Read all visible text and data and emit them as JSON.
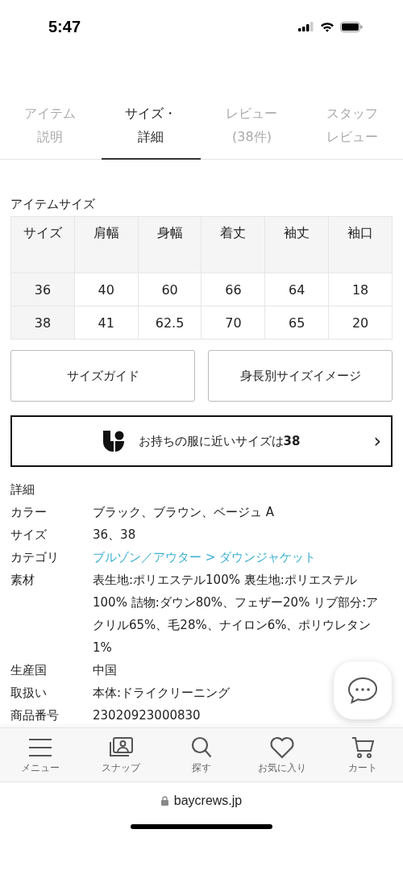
{
  "status_bar": {
    "time": "5:47"
  },
  "tabs": [
    {
      "label": "アイテム説明",
      "selected": false
    },
    {
      "label": "サイズ・詳細",
      "selected": true
    },
    {
      "label": "レビュー(38件)",
      "selected": false
    },
    {
      "label": "スタッフレビュー",
      "selected": false
    }
  ],
  "size_table": {
    "title": "アイテムサイズ",
    "columns": [
      "サイズ",
      "肩幅",
      "身幅",
      "着丈",
      "袖丈",
      "袖口"
    ],
    "rows": [
      [
        "36",
        "40",
        "60",
        "66",
        "64",
        "18"
      ],
      [
        "38",
        "41",
        "62.5",
        "70",
        "65",
        "20"
      ]
    ]
  },
  "size_buttons": [
    "サイズガイド",
    "身長別サイズイメージ"
  ],
  "fit_banner": {
    "text": "お持ちの服に近いサイズは**38**",
    "arrow": "›"
  },
  "details": {
    "title": "詳細",
    "rows": [
      {
        "label": "カラー",
        "value": "ブラック、ブラウン、ベージュ A",
        "kind": "text"
      },
      {
        "label": "サイズ",
        "value": "36、38",
        "kind": "text"
      },
      {
        "label": "カテゴリ",
        "value": "ブルゾン／アウター > ダウンジャケット",
        "kind": "link"
      },
      {
        "label": "素材",
        "value": "表生地:ポリエステル100% 裏生地:ポリエステル100% 詰物:ダウン80%、フェザー20% リブ部分:アクリル65%、毛28%、ナイロン6%、ポリウレタン1%",
        "kind": "text"
      },
      {
        "label": "生産国",
        "value": "中国",
        "kind": "text"
      },
      {
        "label": "取扱い",
        "value": "本体:ドライクリーニング",
        "kind": "text"
      },
      {
        "label": "商品番号",
        "value": "23020923000830",
        "kind": "text"
      }
    ]
  },
  "bottom_nav": [
    {
      "label": "メニュー",
      "kind": "menu"
    },
    {
      "label": "スナップ",
      "kind": "snap"
    },
    {
      "label": "探す",
      "kind": "search"
    },
    {
      "label": "お気に入り",
      "kind": "heart"
    },
    {
      "label": "カート",
      "kind": "cart"
    }
  ],
  "address_bar": {
    "url": "baycrews.jp"
  }
}
